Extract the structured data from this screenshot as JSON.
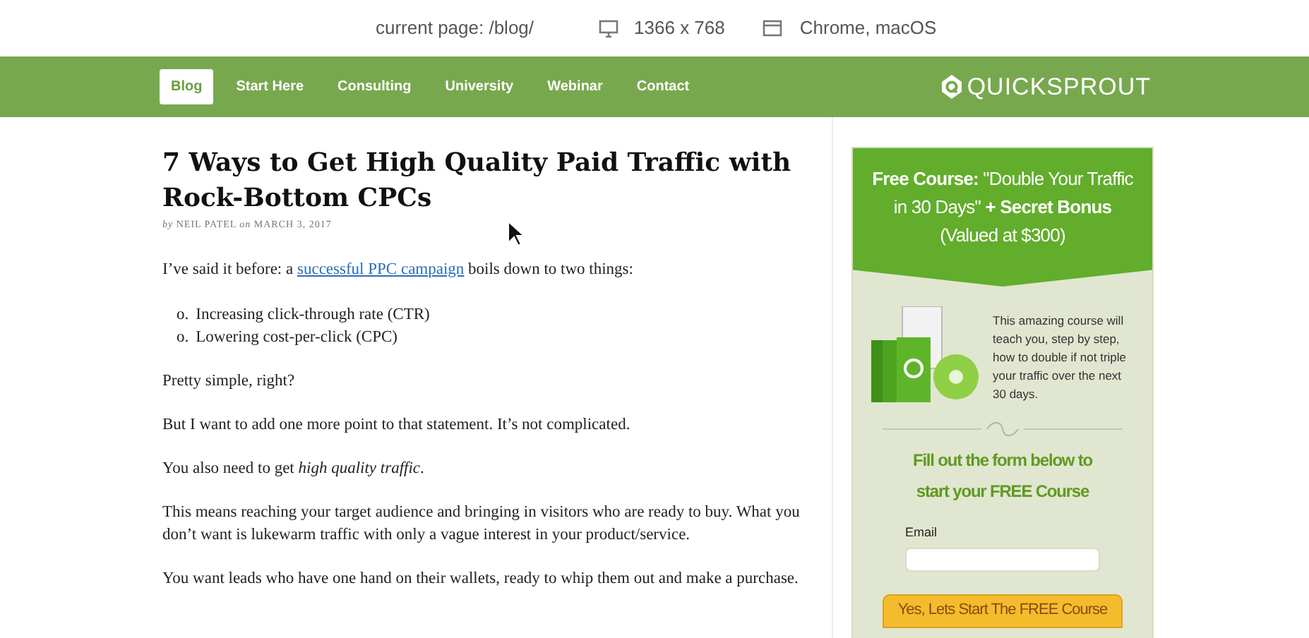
{
  "info_bar": {
    "page": "current page: /blog/",
    "resolution": "1366 x 768",
    "browser": "Chrome, macOS"
  },
  "nav": {
    "items": [
      {
        "label": "Blog",
        "selected": true
      },
      {
        "label": "Start Here",
        "selected": false
      },
      {
        "label": "Consulting",
        "selected": false
      },
      {
        "label": "University",
        "selected": false
      },
      {
        "label": "Webinar",
        "selected": false
      },
      {
        "label": "Contact",
        "selected": false
      }
    ],
    "logo": "QUICKSPROUT"
  },
  "article": {
    "title": "7 Ways to Get High Quality Paid Traffic with Rock-Bottom CPCs",
    "byline": "*by* NEIL PATEL *on* MARCH 3, 2017",
    "intro": {
      "before": "I’ve said it before: a",
      "link": "successful PPC campaign",
      "after": "boils down to two things:"
    },
    "list": [
      {
        "marker": "o.",
        "text": "Increasing click-through rate (CTR)"
      },
      {
        "marker": "o.",
        "text": "Lowering cost-per-click (CPC)"
      }
    ],
    "paragraphs": [
      "Pretty simple, right?",
      "But I want to add one more point to that statement. It’s not complicated.",
      "You also need to get *high quality traffic*.",
      "This means reaching your target audience and bringing in visitors who are ready to buy. What you don’t want is lukewarm traffic with only a vague interest in your product/service.",
      "You want leads who have one hand on their wallets, ready to whip them out and make a purchase."
    ]
  },
  "sidebar": {
    "headline": "**Free Course:** \"Double Your Traffic in 30 Days\" **+ Secret Bonus** (Valued at $300)",
    "description": "This amazing course will teach you, step by step, how to double if not triple your traffic over the next 30 days.",
    "form_heading": "Fill out the form below to start your FREE Course",
    "email_label": "Email",
    "button": "Yes, Lets Start The FREE Course"
  }
}
